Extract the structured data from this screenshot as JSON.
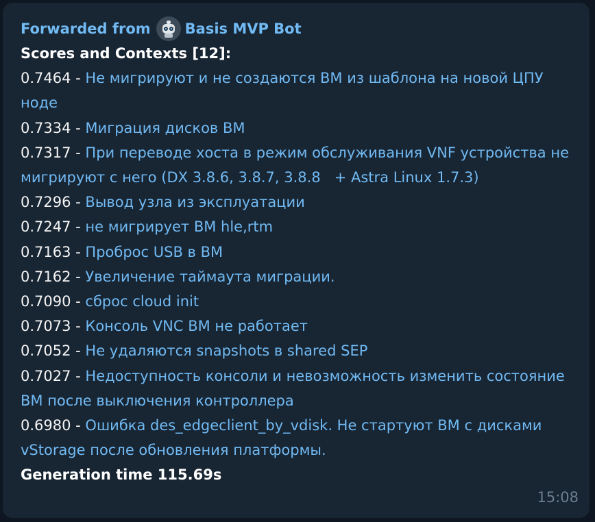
{
  "message": {
    "forwarded_prefix": "Forwarded from",
    "bot_name": "Basis MVP Bot",
    "bot_avatar_icon": "robot-avatar-icon",
    "title": "Scores and Contexts [12]:",
    "results": [
      {
        "score": "0.7464",
        "separator": " - ",
        "text": "Не мигрируют и не создаются ВМ из шаблона на новой ЦПУ ноде"
      },
      {
        "score": "0.7334",
        "separator": " - ",
        "text": "Миграция дисков ВМ"
      },
      {
        "score": "0.7317",
        "separator": " - ",
        "text": "При переводе хоста в режим обслуживания VNF устройства не мигрируют с него (DX 3.8.6, 3.8.7, 3.8.8   + Astra Linux 1.7.3)"
      },
      {
        "score": "0.7296",
        "separator": " - ",
        "text": "Вывод узла из эксплуатации"
      },
      {
        "score": "0.7247",
        "separator": " - ",
        "text": "не мигрирует ВМ hle,rtm"
      },
      {
        "score": "0.7163",
        "separator": " - ",
        "text": "Проброс USB в ВМ"
      },
      {
        "score": "0.7162",
        "separator": " - ",
        "text": "Увеличение таймаута миграции."
      },
      {
        "score": "0.7090",
        "separator": " - ",
        "text": "сброс cloud init"
      },
      {
        "score": "0.7073",
        "separator": " - ",
        "text": "Консоль VNC ВМ не работает"
      },
      {
        "score": "0.7052",
        "separator": " - ",
        "text": "Не удаляются snapshots в shared SEP"
      },
      {
        "score": "0.7027",
        "separator": " - ",
        "text": "Недоступность консоли и невозможность изменить состояние ВМ после выключения контроллера"
      },
      {
        "score": "0.6980",
        "separator": " - ",
        "text": "Ошибка des_edgeclient_by_vdisk. Не стартуют ВМ с дисками vStorage после обновления платформы."
      }
    ],
    "generation_label": "Generation time 115.69s",
    "timestamp": "15:08"
  },
  "colors": {
    "background": "#0e1621",
    "bubble": "#182533",
    "link": "#71baf3",
    "text": "#f5f5f5",
    "timestamp": "#6d7f8f"
  }
}
